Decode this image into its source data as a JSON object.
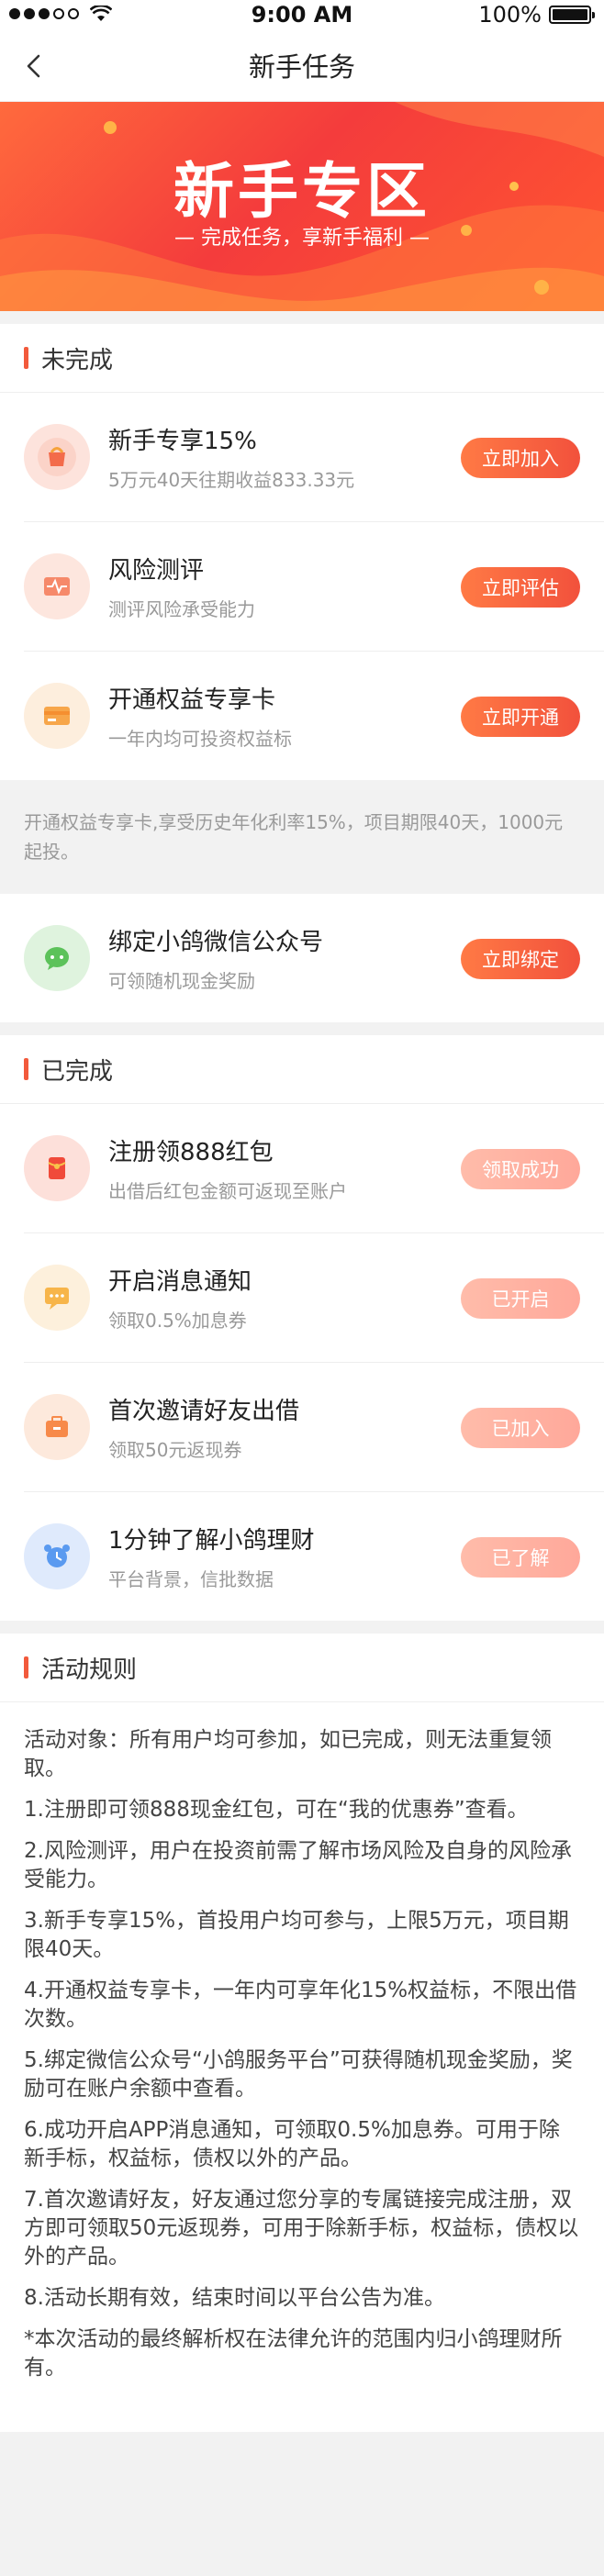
{
  "status": {
    "time": "9:00 AM",
    "battery": "100%",
    "battery_level": 1.0
  },
  "nav": {
    "title": "新手任务"
  },
  "banner": {
    "title": "新手专区",
    "subtitle": "— 完成任务，享新手福利 —"
  },
  "pending": {
    "title": "未完成",
    "items": [
      {
        "name": "新手专享15%",
        "desc": "5万元40天往期收益833.33元",
        "button": "立即加入"
      },
      {
        "name": "风险测评",
        "desc": "测评风险承受能力",
        "button": "立即评估"
      },
      {
        "name": "开通权益专享卡",
        "desc": "一年内均可投资权益标",
        "button": "立即开通"
      }
    ],
    "note": "开通权益专享卡,享受历史年化利率15%，项目期限40天，1000元起投。"
  },
  "wechat": {
    "name": "绑定小鸽微信公众号",
    "desc": "可领随机现金奖励",
    "button": "立即绑定"
  },
  "completed": {
    "title": "已完成",
    "items": [
      {
        "name": "注册领888红包",
        "desc": "出借后红包金额可返现至账户",
        "button": "领取成功"
      },
      {
        "name": "开启消息通知",
        "desc": "领取0.5%加息券",
        "button": "已开启"
      },
      {
        "name": "首次邀请好友出借",
        "desc": "领取50元返现券",
        "button": "已加入"
      },
      {
        "name": "1分钟了解小鸽理财",
        "desc": "平台背景，信批数据",
        "button": "已了解"
      }
    ]
  },
  "rules": {
    "title": "活动规则",
    "lines": [
      "活动对象：所有用户均可参加，如已完成，则无法重复领取。",
      "1.注册即可领888现金红包，可在“我的优惠券”查看。",
      "2.风险测评，用户在投资前需了解市场风险及自身的风险承受能力。",
      "3.新手专享15%，首投用户均可参与，上限5万元，项目期限40天。",
      "4.开通权益专享卡，一年内可享年化15%权益标，不限出借次数。",
      "5.绑定微信公众号“小鸽服务平台”可获得随机现金奖励，奖励可在账户余额中查看。",
      "6.成功开启APP消息通知，可领取0.5%加息券。可用于除新手标，权益标，债权以外的产品。",
      "7.首次邀请好友，好友通过您分享的专属链接完成注册，双方即可领取50元返现券，可用于除新手标，权益标，债权以外的产品。",
      "8.活动长期有效，结束时间以平台公告为准。",
      "*本次活动的最终解析权在法律允许的范围内归小鸽理财所有。"
    ]
  },
  "colors": {
    "accent": "#f2513c",
    "accent_light": "#ff7a45",
    "done": "#ffb0a0"
  }
}
